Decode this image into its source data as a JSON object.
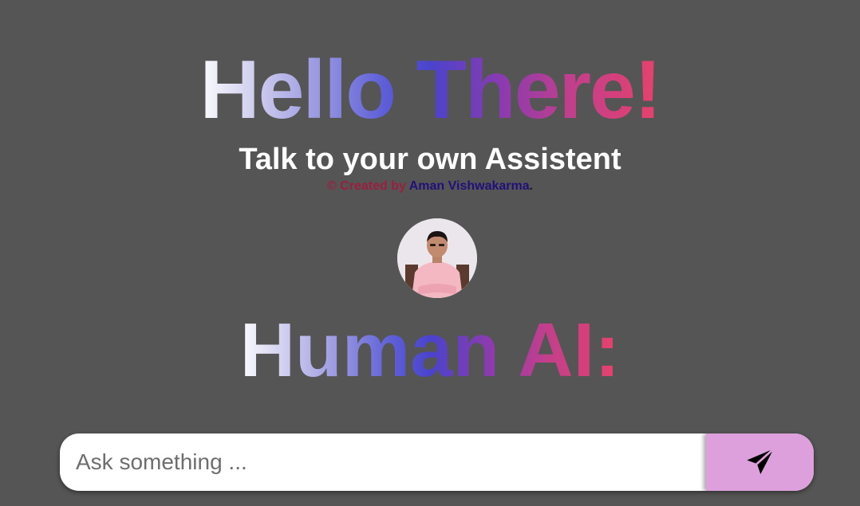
{
  "header": {
    "title": "Hello There!",
    "subtitle": "Talk to your own Assistent",
    "credit_prefix": "© Created by ",
    "credit_name": "Aman Vishwakarma",
    "credit_suffix": "."
  },
  "avatar": {
    "alt": "profile photo"
  },
  "brand": {
    "name": "Human AI:"
  },
  "chat": {
    "placeholder": "Ask something ...",
    "value": "",
    "send_icon": "send-icon"
  },
  "colors": {
    "background": "#555555",
    "send_button": "#dda0dd",
    "gradient_start": "#ffffff",
    "gradient_mid": "#4a43cc",
    "gradient_end": "#e8426a",
    "credit_red": "#9b1f3e",
    "credit_blue": "#22107a"
  }
}
